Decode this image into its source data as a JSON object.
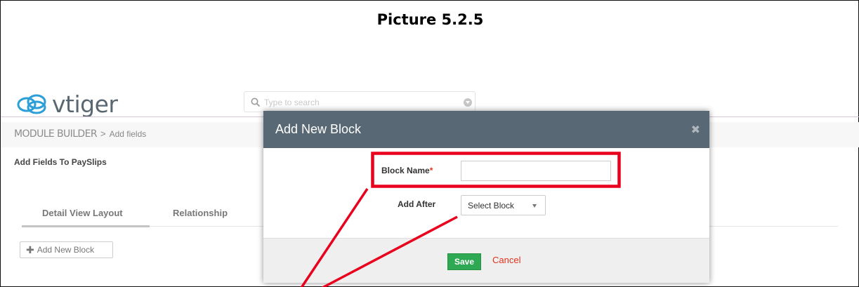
{
  "caption": "Picture 5.2.5",
  "brand": {
    "logo_text": "vtiger"
  },
  "search": {
    "placeholder": "Type to search"
  },
  "breadcrumb": {
    "module": "MODULE BUILDER",
    "separator": ">",
    "page": "Add fields"
  },
  "subtitle": "Add Fields To PaySlips",
  "tabs": [
    {
      "label": "Detail View Layout",
      "active": true
    },
    {
      "label": "Relationship",
      "active": false
    }
  ],
  "add_block_button": {
    "icon": "plus-icon",
    "label": "Add New Block"
  },
  "modal": {
    "title": "Add New Block",
    "close_icon": "close-icon",
    "block_name_label": "Block Name",
    "required_marker": "*",
    "block_name_value": "",
    "add_after_label": "Add After",
    "select_value": "Select Block",
    "save_label": "Save",
    "cancel_label": "Cancel"
  },
  "colors": {
    "modal_header": "#596875",
    "save_green": "#2ea852",
    "cancel_red": "#e0341c",
    "annotation_red": "#e8001c",
    "header_divider": "#d7c6d7"
  }
}
